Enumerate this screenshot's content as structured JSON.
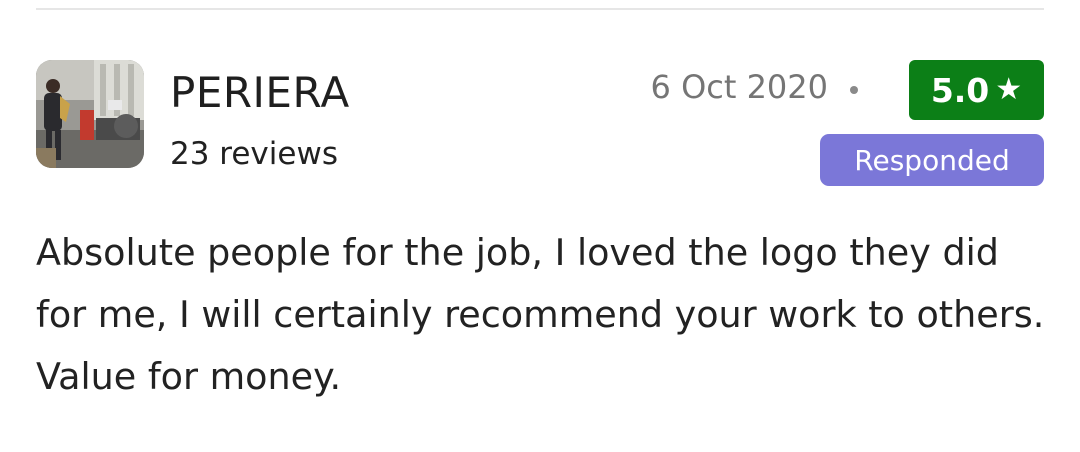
{
  "review": {
    "author": {
      "name": "PERIERA",
      "review_count": "23 reviews"
    },
    "date": "6 Oct 2020",
    "rating": {
      "value": "5.0",
      "star_glyph": "★",
      "icon": "star-icon",
      "color": "#0c7f17"
    },
    "status_badge": {
      "label": "Responded",
      "color": "#7b77d8"
    },
    "text": "Absolute people for the job, I loved the logo they did for me, I will certainly recommend your work to others. Value for money."
  }
}
